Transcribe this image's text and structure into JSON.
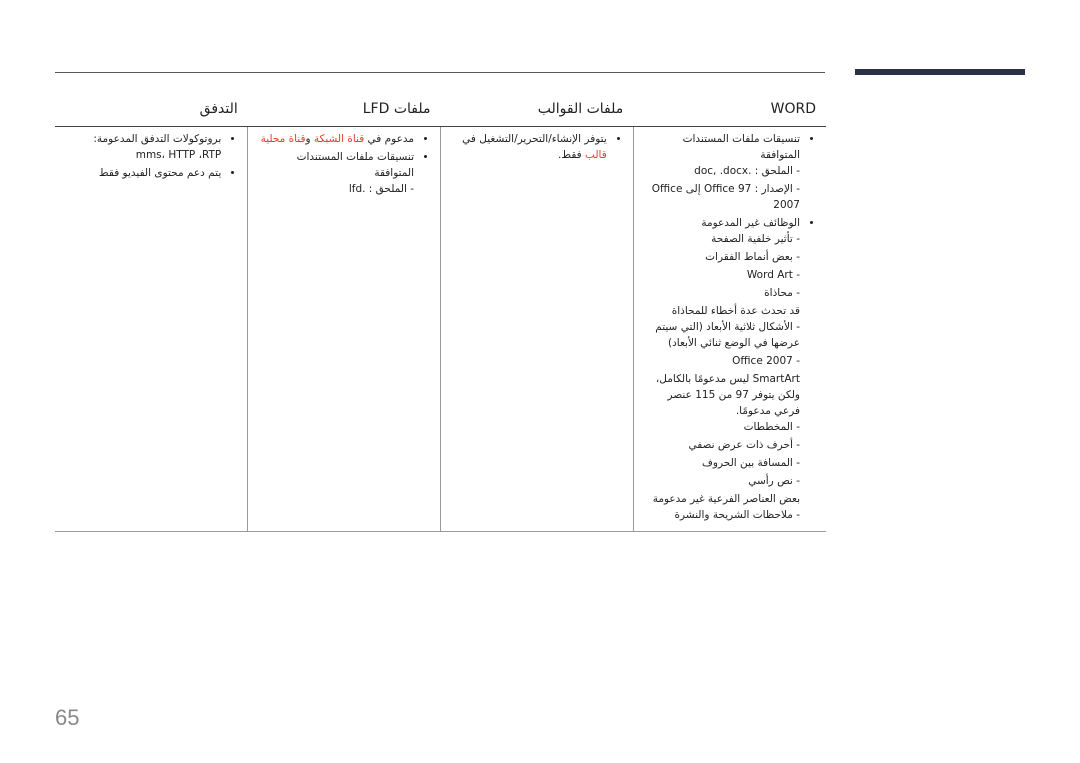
{
  "headers": [
    "WORD",
    "ملفات القوالب",
    "ملفات LFD",
    "التدفق"
  ],
  "word": {
    "b1": "تنسيقات ملفات المستندات المتوافقة",
    "b1_sub": [
      "الملحق : .doc, .docx",
      "الإصدار : Office 97 إلى Office 2007"
    ],
    "b2": "الوظائف غير المدعومة",
    "b2_sub": [
      "تأثير خلفية الصفحة",
      "بعض أنماط الفقرات",
      "Word Art",
      "محاذاة"
    ],
    "note1": "قد تحدث عدة أخطاء للمحاذاة",
    "b2_sub2": [
      "الأشكال ثلاثية الأبعاد (التي سيتم عرضها في الوضع ثنائي الأبعاد)",
      "Office 2007"
    ],
    "note2": "SmartArt ليس مدعومًا بالكامل، ولكن يتوفر 97 من 115 عنصر فرعي مدعومًا.",
    "b2_sub3": [
      "المخططات",
      "أحرف ذات عرض نصفي",
      "المسافة بين الحروف",
      "نص رأسي"
    ],
    "note3": "بعض العناصر الفرعية غير مدعومة",
    "b2_sub4": [
      "ملاحظات الشريحة والنشرة"
    ]
  },
  "templates": {
    "t1": "يتوفر الإنشاء/التحرير/التشغيل في ",
    "t1_red": "قالب",
    "t1_end": " فقط."
  },
  "lfd": {
    "t1": "مدعوم في ",
    "t1_red1": "قناة الشبكة",
    "t1_mid": " و",
    "t1_red2": "قناة محلية",
    "b2": "تنسيقات ملفات المستندات المتوافقة",
    "b2_sub": [
      "الملحق : .lfd"
    ]
  },
  "streaming": {
    "b1": "بروتوكولات التدفق المدعومة: mms، HTTP ،RTP",
    "b2": "يتم دعم محتوى الفيديو فقط"
  },
  "page_number": "65",
  "colors": {
    "highlight": "#e0402a",
    "bar": "#2a3045"
  }
}
